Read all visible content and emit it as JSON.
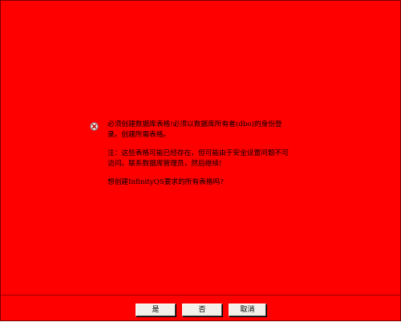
{
  "dialog": {
    "icon": "error-icon",
    "background_color": "#ff0000",
    "messages": [
      "必须创建数据库表格!必须以数据库所有者(dbo)的身份登\n录。创建所需表格。",
      "注：这些表格可能已经存在，但可能由于安全设置问题不可\n访问。联系数据库管理员，然后继续!",
      "想创建InfinityQS要求的所有表格吗?"
    ],
    "buttons": {
      "yes": "是",
      "no": "否",
      "cancel": "取消"
    }
  }
}
